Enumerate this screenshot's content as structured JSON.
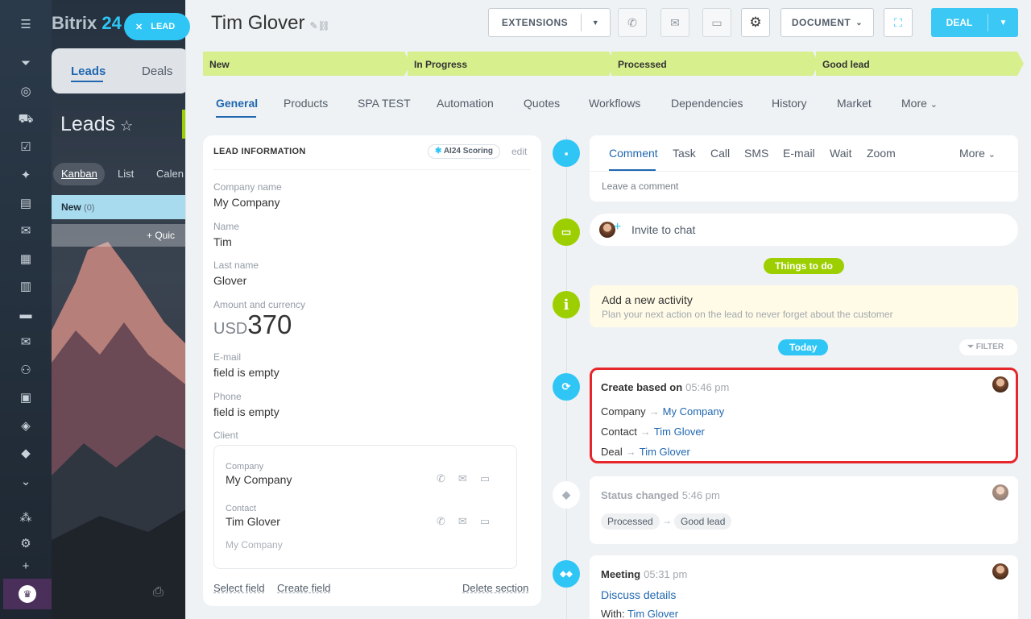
{
  "brand": {
    "name": "Bitrix",
    "number": "24"
  },
  "lead_tag": "LEAD",
  "bg": {
    "tabs": [
      "Leads",
      "Deals"
    ],
    "title": "Leads",
    "views": [
      "Kanban",
      "List",
      "Calen"
    ],
    "column": {
      "name": "New",
      "count": "(0)"
    },
    "quick": "+ Quic"
  },
  "header": {
    "title": "Tim Glover",
    "extensions": "EXTENSIONS",
    "document": "DOCUMENT",
    "deal": "DEAL"
  },
  "stages": [
    "New",
    "In Progress",
    "Processed",
    "Good lead"
  ],
  "tabs": [
    "General",
    "Products",
    "SPA TEST",
    "Automation",
    "Quotes",
    "Workflows",
    "Dependencies",
    "History",
    "Market",
    "More"
  ],
  "lead_info": {
    "heading": "LEAD INFORMATION",
    "ai_scoring": "AI24 Scoring",
    "edit": "edit",
    "fields": [
      {
        "label": "Company name",
        "value": "My Company"
      },
      {
        "label": "Name",
        "value": "Tim"
      },
      {
        "label": "Last name",
        "value": "Glover"
      }
    ],
    "amount": {
      "label": "Amount and currency",
      "currency": "USD",
      "value": "370"
    },
    "email": {
      "label": "E-mail",
      "value": "field is empty"
    },
    "phone": {
      "label": "Phone",
      "value": "field is empty"
    },
    "client": {
      "label": "Client",
      "company_label": "Company",
      "company": "My Company",
      "contact_label": "Contact",
      "contact": "Tim Glover",
      "contact_company": "My Company"
    },
    "links": {
      "select": "Select field",
      "create": "Create field",
      "delete": "Delete section"
    }
  },
  "composer": {
    "tabs": [
      "Comment",
      "Task",
      "Call",
      "SMS",
      "E-mail",
      "Wait",
      "Zoom"
    ],
    "more": "More",
    "placeholder": "Leave a comment"
  },
  "chat": {
    "invite": "Invite to chat"
  },
  "things_to_do": "Things to do",
  "activity": {
    "title": "Add a new activity",
    "subtitle": "Plan your next action on the lead to never forget about the customer"
  },
  "today": "Today",
  "filter": "FILTER",
  "create_based": {
    "title": "Create based on",
    "time": "05:46 pm",
    "rows": [
      {
        "label": "Company",
        "value": "My Company"
      },
      {
        "label": "Contact",
        "value": "Tim Glover"
      },
      {
        "label": "Deal",
        "value": "Tim Glover"
      }
    ]
  },
  "status_changed": {
    "title": "Status changed",
    "time": "5:46 pm",
    "from": "Processed",
    "to": "Good lead"
  },
  "meeting": {
    "title": "Meeting",
    "time": "05:31 pm",
    "subject": "Discuss details",
    "with_label": "With:",
    "with": "Tim Glover"
  },
  "colors": {
    "accent": "#2067b0",
    "stage": "#d7ef8c",
    "deal": "#3bc8f5",
    "green": "#9dcf00",
    "highlight": "#e6262b"
  }
}
